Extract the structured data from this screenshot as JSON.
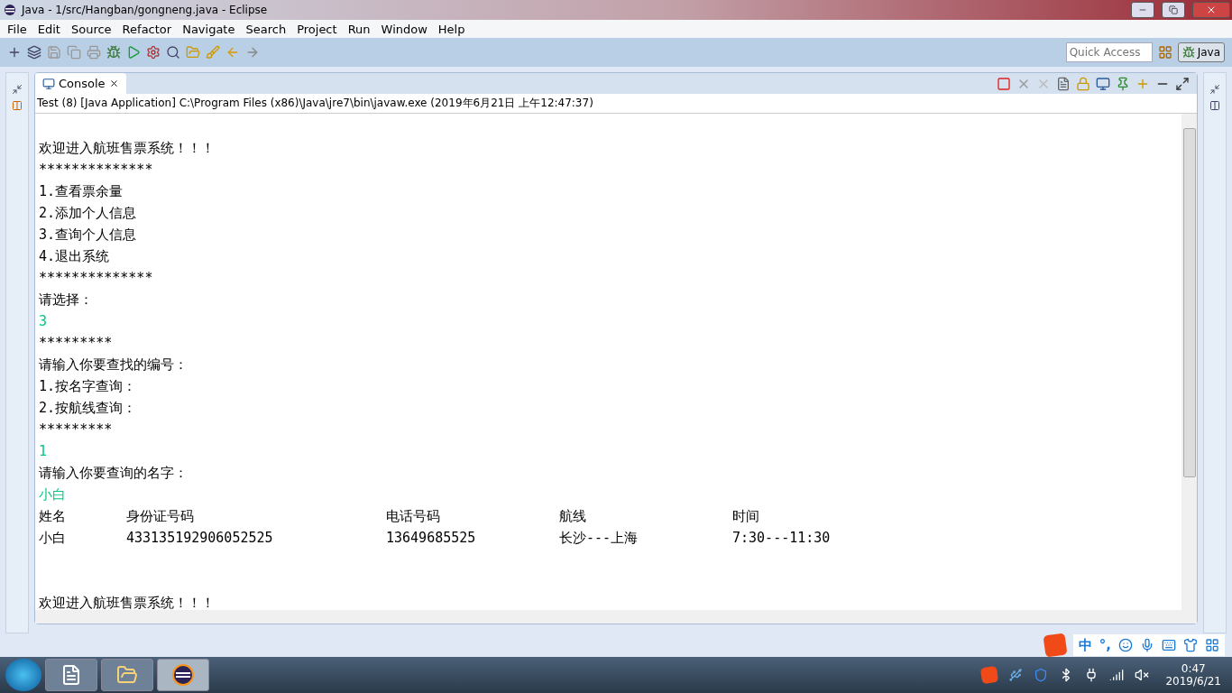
{
  "window": {
    "title": "Java - 1/src/Hangban/gongneng.java - Eclipse"
  },
  "menu": [
    "File",
    "Edit",
    "Source",
    "Refactor",
    "Navigate",
    "Search",
    "Project",
    "Run",
    "Window",
    "Help"
  ],
  "quick_access": {
    "placeholder": "Quick Access"
  },
  "perspective": {
    "label": "Java",
    "selected": true
  },
  "console": {
    "tab": "Console",
    "description": "Test (8) [Java Application] C:\\Program Files (x86)\\Java\\jre7\\bin\\javaw.exe (2019年6月21日 上午12:47:37)",
    "lines": [
      {
        "kind": "blank"
      },
      {
        "kind": "output",
        "text": "欢迎进入航班售票系统！！！"
      },
      {
        "kind": "output",
        "text": "**************"
      },
      {
        "kind": "output",
        "text": "1.查看票余量"
      },
      {
        "kind": "output",
        "text": "2.添加个人信息"
      },
      {
        "kind": "output",
        "text": "3.查询个人信息"
      },
      {
        "kind": "output",
        "text": "4.退出系统"
      },
      {
        "kind": "output",
        "text": "**************"
      },
      {
        "kind": "output",
        "text": "请选择："
      },
      {
        "kind": "input",
        "text": "3"
      },
      {
        "kind": "output",
        "text": "*********"
      },
      {
        "kind": "output",
        "text": "请输入你要查找的编号："
      },
      {
        "kind": "output",
        "text": "1.按名字查询："
      },
      {
        "kind": "output",
        "text": "2.按航线查询："
      },
      {
        "kind": "output",
        "text": "*********"
      },
      {
        "kind": "input",
        "text": "1"
      },
      {
        "kind": "output",
        "text": "请输入你要查询的名字："
      },
      {
        "kind": "input",
        "text": "小白"
      },
      {
        "kind": "row",
        "cells": [
          "姓名",
          "身份证号码",
          "电话号码",
          "航线",
          "时间"
        ]
      },
      {
        "kind": "row",
        "cells": [
          "小白",
          "433135192906052525",
          "13649685525",
          "长沙---上海",
          "7:30---11:30"
        ]
      },
      {
        "kind": "blank"
      },
      {
        "kind": "blank"
      },
      {
        "kind": "output",
        "text": "欢迎进入航班售票系统！！！"
      }
    ]
  },
  "ime_bar": [
    "中",
    "°,"
  ],
  "taskbar": {
    "apps": [
      {
        "kind": "word",
        "selected": false
      },
      {
        "kind": "folder",
        "selected": false
      },
      {
        "kind": "eclipse",
        "selected": true
      }
    ],
    "time": "0:47",
    "date": "2019/6/21"
  }
}
